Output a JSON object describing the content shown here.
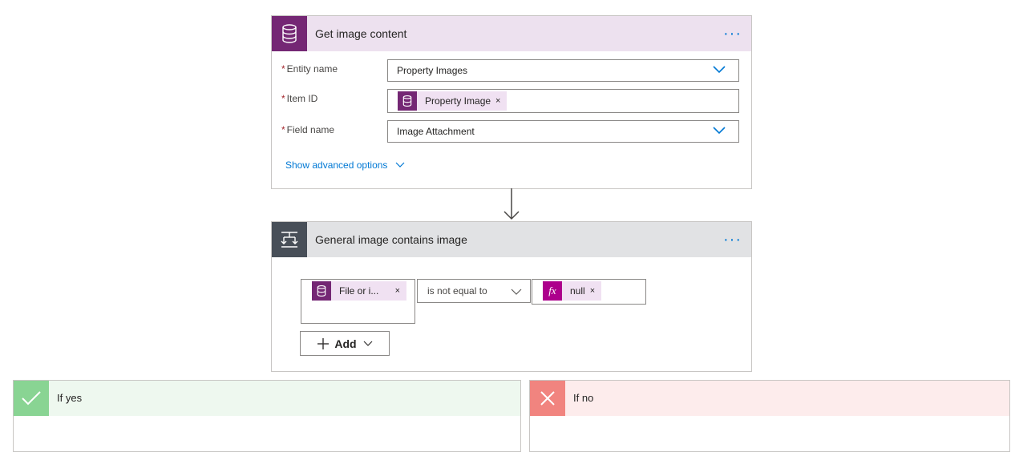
{
  "action1": {
    "title": "Get image content",
    "icon": "database-icon",
    "header_color": "#ede1ef",
    "icon_bg": "#742774",
    "more_label": "···",
    "fields": [
      {
        "label": "Entity name",
        "required_mark": "*",
        "value": "Property Images"
      },
      {
        "label": "Item ID",
        "required_mark": "*",
        "token": "Property Image",
        "token_remove": "×"
      },
      {
        "label": "Field name",
        "required_mark": "*",
        "value": "Image Attachment"
      }
    ],
    "advanced_label": "Show advanced options"
  },
  "condition": {
    "title": "General image contains image",
    "icon": "condition-icon",
    "header_color": "#e1e2e4",
    "icon_bg": "#484f58",
    "more_label": "···",
    "left_token": "File or i...",
    "left_token_remove": "×",
    "operator": "is not equal to",
    "right_token": "null",
    "right_token_remove": "×",
    "right_token_icon": "fx",
    "add_label": "Add"
  },
  "branches": {
    "yes": {
      "label": "If yes",
      "color": "#eef8ef",
      "icon_bg": "#89d493"
    },
    "no": {
      "label": "If no",
      "color": "#fdecec",
      "icon_bg": "#f1847f"
    }
  }
}
